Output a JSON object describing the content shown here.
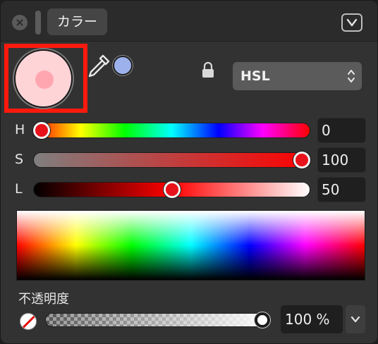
{
  "header": {
    "title": "カラー",
    "close_icon": "close-icon",
    "collapse_icon": "chevron-down-icon"
  },
  "colors": {
    "current_fill": "#ffd4d7",
    "current_center": "#ffa6b1",
    "recent_swatch": "#9db2ec",
    "highlight_frame": "#ff1a0e"
  },
  "tools": {
    "eyedropper_icon": "eyedropper-icon",
    "lock_icon": "lock-icon"
  },
  "mode": {
    "label": "HSL",
    "icon": "up-down-chevron-icon"
  },
  "sliders": [
    {
      "label": "H",
      "value": "0",
      "fraction": 0.0
    },
    {
      "label": "S",
      "value": "100",
      "fraction": 1.0
    },
    {
      "label": "L",
      "value": "50",
      "fraction": 0.5
    }
  ],
  "opacity": {
    "label": "不透明度",
    "value": "100 %",
    "fraction": 1.0,
    "no_color_icon": "no-color-icon",
    "menu_icon": "chevron-down-icon"
  }
}
